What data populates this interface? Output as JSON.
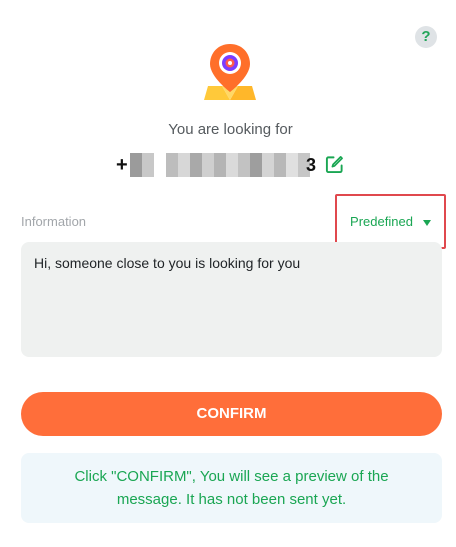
{
  "help": {
    "icon_glyph": "?"
  },
  "header": {
    "looking_for": "You are looking for"
  },
  "phone": {
    "prefix": "+",
    "suffix": "3"
  },
  "info": {
    "label": "Information",
    "template_label": "Predefined",
    "message": "Hi, someone close to you is looking for you"
  },
  "actions": {
    "confirm_label": "CONFIRM"
  },
  "notice": {
    "text": "Click \"CONFIRM\", You will see a preview of the message. It has not been sent yet."
  },
  "colors": {
    "accent_green": "#1aa653",
    "confirm_orange": "#ff6e3a",
    "highlight_red": "#e0484e",
    "logo_orange": "#ff6f2a",
    "logo_purple": "#7b3cff",
    "logo_yellow": "#ffc93a"
  }
}
